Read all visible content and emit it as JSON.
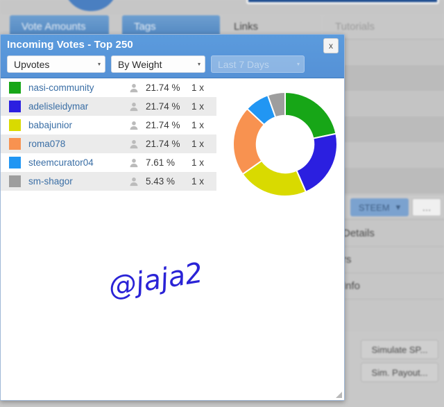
{
  "background": {
    "tabs": [
      {
        "label": "Vote Amounts",
        "state": "active"
      },
      {
        "label": "Tags",
        "state": "active"
      },
      {
        "label": "Links",
        "state": "plain"
      },
      {
        "label": "Tutorials",
        "state": "dim"
      }
    ],
    "toolbar": {
      "currency_label": "STEEM",
      "more_label": "…"
    },
    "list_items": [
      {
        "label": "Details"
      },
      {
        "label": "rs"
      },
      {
        "label": "Info"
      }
    ],
    "buttons": [
      {
        "label": "Simulate SP..."
      },
      {
        "label": "Sim. Payout..."
      }
    ]
  },
  "dialog": {
    "title": "Incoming Votes - Top 250",
    "close_label": "x",
    "filters": [
      {
        "value": "Upvotes",
        "disabled": false
      },
      {
        "value": "By Weight",
        "disabled": false
      },
      {
        "value": "Last 7 Days",
        "disabled": true
      }
    ],
    "rows": [
      {
        "color": "#17a617",
        "name": "nasi-community",
        "percent": "21.74 %",
        "multiplier": "1 x"
      },
      {
        "color": "#2b1fe0",
        "name": "adelisleidymar",
        "percent": "21.74 %",
        "multiplier": "1 x"
      },
      {
        "color": "#d9da00",
        "name": "babajunior",
        "percent": "21.74 %",
        "multiplier": "1 x"
      },
      {
        "color": "#f89250",
        "name": "roma078",
        "percent": "21.74 %",
        "multiplier": "1 x"
      },
      {
        "color": "#2196f3",
        "name": "steemcurator04",
        "percent": "7.61 %",
        "multiplier": "1 x"
      },
      {
        "color": "#9e9e9e",
        "name": "sm-shagor",
        "percent": "5.43 %",
        "multiplier": "1 x"
      }
    ],
    "watermark": "@jaja2"
  },
  "chart_data": {
    "type": "pie",
    "variant": "donut",
    "title": "Incoming Votes - Top 250",
    "categories": [
      "nasi-community",
      "adelisleidymar",
      "babajunior",
      "roma078",
      "steemcurator04",
      "sm-shagor"
    ],
    "values": [
      21.74,
      21.74,
      21.74,
      21.74,
      7.61,
      5.43
    ],
    "unit": "%",
    "colors": [
      "#17a617",
      "#2b1fe0",
      "#d9da00",
      "#f89250",
      "#2196f3",
      "#9e9e9e"
    ],
    "legend": "left-table",
    "inner_radius_ratio": 0.55,
    "start_angle_deg": -90
  }
}
